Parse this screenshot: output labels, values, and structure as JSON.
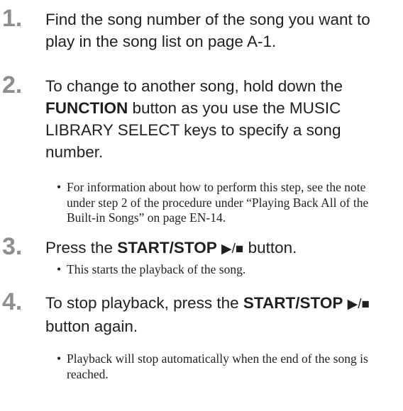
{
  "steps": [
    {
      "number": "1.",
      "text": "Find the song number of the song you want to play in the song list on page A-1."
    },
    {
      "number": "2.",
      "text_before": "To change to another song, hold down the ",
      "bold": "FUNCTION",
      "text_after": " button as you use the MUSIC LIBRARY SELECT keys to specify a song number.",
      "bullet": "For information about how to perform this step, see the note under step 2 of the procedure under “Playing Back All of the Built-in Songs” on page EN-14."
    },
    {
      "number": "3.",
      "text_before": "Press the ",
      "bold": "START/STOP",
      "symbol": "▶/■",
      "text_after": " button.",
      "bullet": "This starts the playback of the song."
    },
    {
      "number": "4.",
      "text_before": "To stop playback, press the ",
      "bold": "START/STOP",
      "symbol": "▶/■",
      "text_after": " button again.",
      "bullet": "Playback will stop automatically when the end of the song is reached."
    }
  ]
}
